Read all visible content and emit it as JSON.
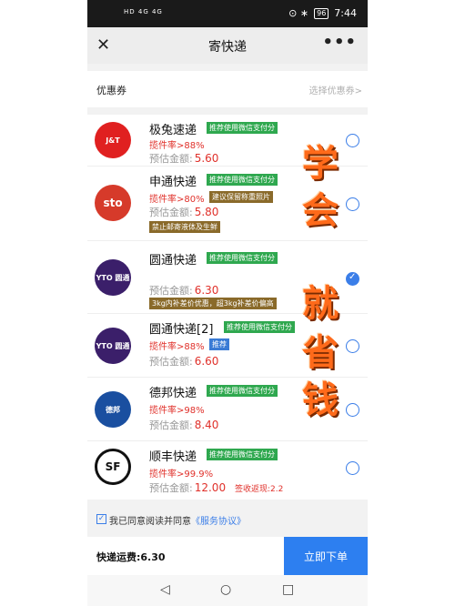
{
  "status": {
    "left": "HD 4G 4G",
    "time": "7:44",
    "battery": "96",
    "icons": "⊙ ∗"
  },
  "header": {
    "title": "寄快递",
    "close": "✕",
    "more": "•••"
  },
  "coupon": {
    "label": "优惠券",
    "select": "选择优惠券>"
  },
  "couriers": [
    {
      "logo": "J&T",
      "logo_color": "#e02020",
      "name": "极兔速递",
      "tag1": "推荐使用微信支付分",
      "price_label": "预估金额:",
      "price": "5.60",
      "rate": "揽件率>88%"
    },
    {
      "logo": "sto",
      "logo_color": "#d63a2a",
      "name": "申通快递",
      "tag1": "推荐使用微信支付分",
      "rate": "揽件率>80%",
      "tag2": "建议保留称重照片",
      "price_label": "预估金额:",
      "price": "5.80",
      "tag3": "禁止邮寄液体及生鲜"
    },
    {
      "logo": "YTO 圆通",
      "logo_color": "#3b1f6a",
      "name": "圆通快递",
      "tag1": "推荐使用微信支付分",
      "price_label": "预估金额:",
      "price": "6.30",
      "tag2": "3kg内补差价优惠，超3kg补差价偏高"
    },
    {
      "logo": "YTO 圆通",
      "logo_color": "#3b1f6a",
      "name": "圆通快递[2]",
      "tag1": "推荐使用微信支付分",
      "rate": "揽件率>88%",
      "tag2": "推荐",
      "price_label": "预估金额:",
      "price": "6.60"
    },
    {
      "logo": "德邦",
      "logo_color": "#1a4fa0",
      "name": "德邦快递",
      "tag1": "推荐使用微信支付分",
      "rate": "揽件率>98%",
      "price_label": "预估金额:",
      "price": "8.40"
    },
    {
      "logo": "SF",
      "logo_color": "#111111",
      "name": "顺丰快递",
      "tag1": "推荐使用微信支付分",
      "rate": "揽件率>99.9%",
      "price_label": "预估金额:",
      "price": "12.00",
      "extra": "签收返现:2.2"
    }
  ],
  "overlay_text": [
    "学",
    "会",
    "就",
    "省",
    "钱"
  ],
  "agree": {
    "text": "我已同意阅读并同意",
    "link": "《服务协议》"
  },
  "footer": {
    "fee": "快递运费:6.30",
    "submit": "立即下单"
  },
  "nav": {
    "back": "◁",
    "home": "○",
    "recent": "□"
  }
}
